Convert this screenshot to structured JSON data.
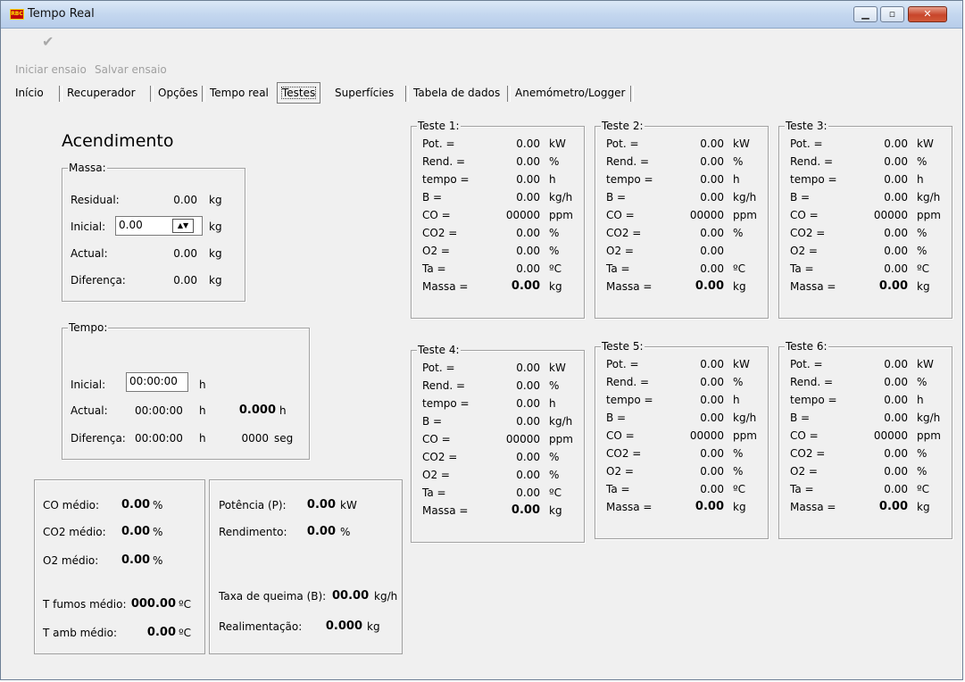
{
  "window": {
    "title": "Tempo Real",
    "icon_text": "RBC",
    "icon": "app-logo-icon",
    "min_icon": "minimize-icon",
    "max_icon": "maximize-icon",
    "close_icon": "close-icon"
  },
  "toolbar": {
    "iniciar_label": "Iniciar ensaio",
    "salvar_label": "Salvar ensaio",
    "check_icon": "checkmark-icon"
  },
  "tabs": [
    {
      "label": "Início"
    },
    {
      "label": "Recuperador"
    },
    {
      "label": "Opções"
    },
    {
      "label": "Tempo real"
    },
    {
      "label": "Testes",
      "active": true
    },
    {
      "label": "Superfícies"
    },
    {
      "label": "Tabela de dados"
    },
    {
      "label": "Anemómetro/Logger"
    }
  ],
  "acendimento": {
    "heading": "Acendimento",
    "massa": {
      "legend": "Massa:",
      "residual_label": "Residual:",
      "residual_value": "0.00",
      "residual_unit": "kg",
      "inicial_label": "Inicial:",
      "inicial_value": "0.00",
      "inicial_unit": "kg",
      "actual_label": "Actual:",
      "actual_value": "0.00",
      "actual_unit": "kg",
      "diferenca_label": "Diferença:",
      "diferenca_value": "0.00",
      "diferenca_unit": "kg"
    },
    "tempo": {
      "legend": "Tempo:",
      "inicial_label": "Inicial:",
      "inicial_value": "00:00:00",
      "inicial_unit": "h",
      "actual_label": "Actual:",
      "actual_value": "00:00:00",
      "actual_unit": "h",
      "actual_hours": "0.000",
      "actual_hours_unit": "h",
      "diferenca_label": "Diferença:",
      "diferenca_value": "00:00:00",
      "diferenca_unit": "h",
      "diferenca_seg": "0000",
      "diferenca_seg_unit": "seg"
    }
  },
  "medias": {
    "co_label": "CO médio:",
    "co_value": "0.00",
    "co_unit": "%",
    "co2_label": "CO2 médio:",
    "co2_value": "0.00",
    "co2_unit": "%",
    "o2_label": "O2 médio:",
    "o2_value": "0.00",
    "o2_unit": "%",
    "tfumos_label": "T fumos médio:",
    "tfumos_value": "000.00",
    "tfumos_unit": "ºC",
    "tamb_label": "T amb médio:",
    "tamb_value": "0.00",
    "tamb_unit": "ºC"
  },
  "resultados": {
    "potencia_label": "Potência (P):",
    "potencia_value": "0.00",
    "potencia_unit": "kW",
    "rendimento_label": "Rendimento:",
    "rendimento_value": "0.00",
    "rendimento_unit": "%",
    "taxa_label": "Taxa de queima (B):",
    "taxa_value": "00.00",
    "taxa_unit": "kg/h",
    "realim_label": "Realimentação:",
    "realim_value": "0.000",
    "realim_unit": "kg"
  },
  "testes": [
    {
      "legend": "Teste 1:",
      "rows": [
        {
          "label": "Pot. =",
          "value": "0.00",
          "unit": "kW"
        },
        {
          "label": "Rend. =",
          "value": "0.00",
          "unit": "%"
        },
        {
          "label": "tempo =",
          "value": "0.00",
          "unit": "h"
        },
        {
          "label": "B =",
          "value": "0.00",
          "unit": "kg/h"
        },
        {
          "label": "CO =",
          "value": "00000",
          "unit": "ppm"
        },
        {
          "label": "CO2 =",
          "value": "0.00",
          "unit": "%"
        },
        {
          "label": "O2 =",
          "value": "0.00",
          "unit": "%"
        },
        {
          "label": "Ta =",
          "value": "0.00",
          "unit": "ºC"
        },
        {
          "label": "Massa =",
          "value": "0.00",
          "unit": "kg",
          "bold": true
        }
      ]
    },
    {
      "legend": "Teste 2:",
      "rows": [
        {
          "label": "Pot. =",
          "value": "0.00",
          "unit": "kW"
        },
        {
          "label": "Rend. =",
          "value": "0.00",
          "unit": "%"
        },
        {
          "label": "tempo =",
          "value": "0.00",
          "unit": "h"
        },
        {
          "label": "B =",
          "value": "0.00",
          "unit": "kg/h"
        },
        {
          "label": "CO =",
          "value": "00000",
          "unit": "ppm"
        },
        {
          "label": "CO2 =",
          "value": "0.00",
          "unit": "%"
        },
        {
          "label": "O2 =",
          "value": "0.00",
          "unit": ""
        },
        {
          "label": "Ta =",
          "value": "0.00",
          "unit": "ºC"
        },
        {
          "label": "Massa =",
          "value": "0.00",
          "unit": "kg",
          "bold": true
        }
      ]
    },
    {
      "legend": "Teste 3:",
      "rows": [
        {
          "label": "Pot. =",
          "value": "0.00",
          "unit": "kW"
        },
        {
          "label": "Rend. =",
          "value": "0.00",
          "unit": "%"
        },
        {
          "label": "tempo =",
          "value": "0.00",
          "unit": "h"
        },
        {
          "label": "B =",
          "value": "0.00",
          "unit": "kg/h"
        },
        {
          "label": "CO =",
          "value": "00000",
          "unit": "ppm"
        },
        {
          "label": "CO2 =",
          "value": "0.00",
          "unit": "%"
        },
        {
          "label": "O2 =",
          "value": "0.00",
          "unit": "%"
        },
        {
          "label": "Ta =",
          "value": "0.00",
          "unit": "ºC"
        },
        {
          "label": "Massa =",
          "value": "0.00",
          "unit": "kg",
          "bold": true
        }
      ]
    },
    {
      "legend": "Teste 4:",
      "rows": [
        {
          "label": "Pot. =",
          "value": "0.00",
          "unit": "kW"
        },
        {
          "label": "Rend. =",
          "value": "0.00",
          "unit": "%"
        },
        {
          "label": "tempo =",
          "value": "0.00",
          "unit": "h"
        },
        {
          "label": "B =",
          "value": "0.00",
          "unit": "kg/h"
        },
        {
          "label": "CO =",
          "value": "00000",
          "unit": "ppm"
        },
        {
          "label": "CO2 =",
          "value": "0.00",
          "unit": "%"
        },
        {
          "label": "O2 =",
          "value": "0.00",
          "unit": "%"
        },
        {
          "label": "Ta =",
          "value": "0.00",
          "unit": "ºC"
        },
        {
          "label": "Massa =",
          "value": "0.00",
          "unit": "kg",
          "bold": true
        }
      ]
    },
    {
      "legend": "Teste 5:",
      "rows": [
        {
          "label": "Pot. =",
          "value": "0.00",
          "unit": "kW"
        },
        {
          "label": "Rend. =",
          "value": "0.00",
          "unit": "%"
        },
        {
          "label": "tempo =",
          "value": "0.00",
          "unit": "h"
        },
        {
          "label": "B =",
          "value": "0.00",
          "unit": "kg/h"
        },
        {
          "label": "CO =",
          "value": "00000",
          "unit": "ppm"
        },
        {
          "label": "CO2 =",
          "value": "0.00",
          "unit": "%"
        },
        {
          "label": "O2 =",
          "value": "0.00",
          "unit": "%"
        },
        {
          "label": "Ta =",
          "value": "0.00",
          "unit": "ºC"
        },
        {
          "label": "Massa =",
          "value": "0.00",
          "unit": "kg",
          "bold": true
        }
      ]
    },
    {
      "legend": "Teste 6:",
      "rows": [
        {
          "label": "Pot. =",
          "value": "0.00",
          "unit": "kW"
        },
        {
          "label": "Rend. =",
          "value": "0.00",
          "unit": "%"
        },
        {
          "label": "tempo =",
          "value": "0.00",
          "unit": "h"
        },
        {
          "label": "B =",
          "value": "0.00",
          "unit": "kg/h"
        },
        {
          "label": "CO =",
          "value": "00000",
          "unit": "ppm"
        },
        {
          "label": "CO2 =",
          "value": "0.00",
          "unit": "%"
        },
        {
          "label": "O2 =",
          "value": "0.00",
          "unit": "%"
        },
        {
          "label": "Ta =",
          "value": "0.00",
          "unit": "ºC"
        },
        {
          "label": "Massa =",
          "value": "0.00",
          "unit": "kg",
          "bold": true
        }
      ]
    }
  ],
  "colors": {
    "title_bar": "#c4d7ef",
    "close_button": "#c8452a",
    "background": "#f0f0f0",
    "disabled_text": "#a0a0a0"
  }
}
